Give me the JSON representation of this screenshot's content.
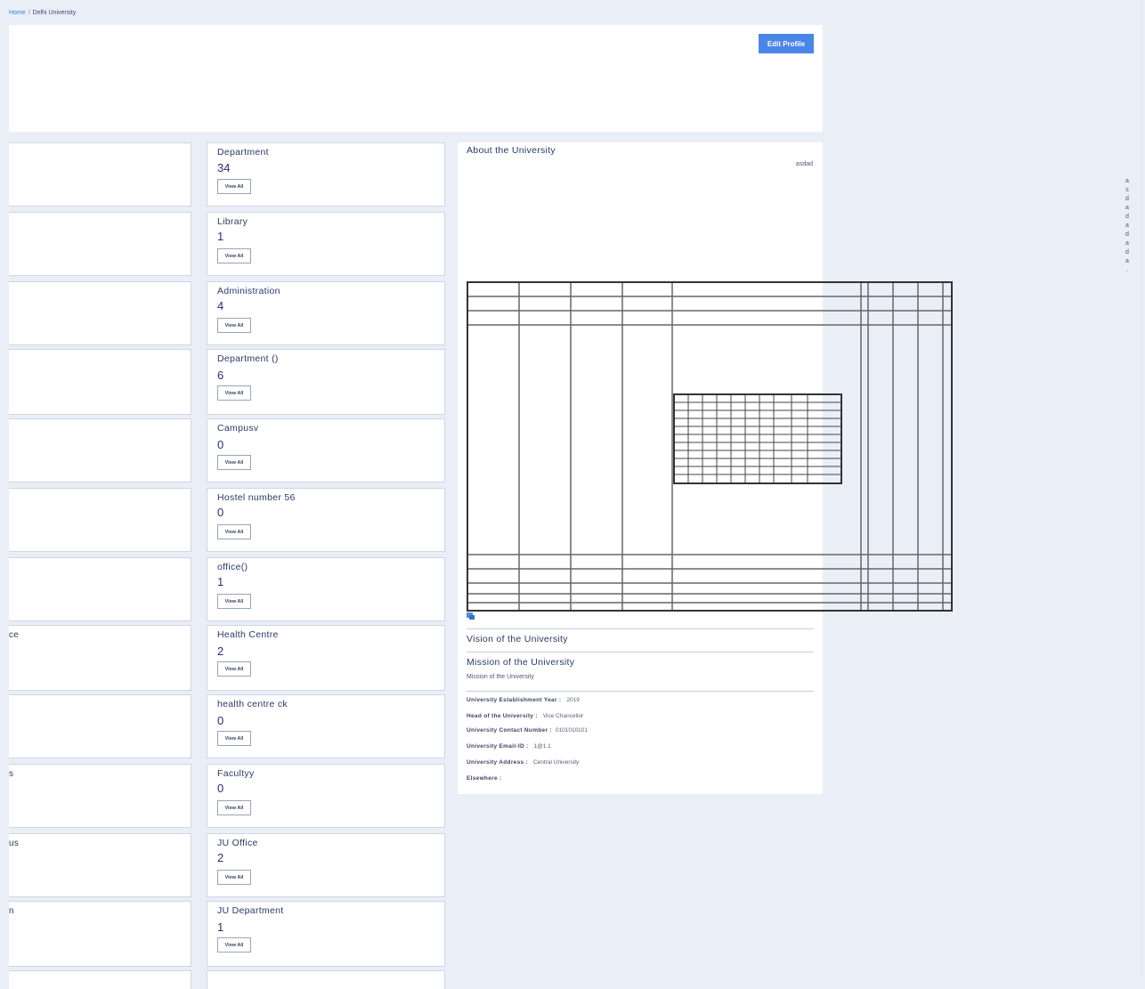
{
  "breadcrumb": {
    "home": "Home",
    "separator": "/",
    "current": "Delhi University"
  },
  "header": {
    "edit_profile": "Edit Profile"
  },
  "left_cards": [
    "",
    "",
    "",
    "",
    "",
    "",
    "",
    "ce",
    "",
    "s",
    "us",
    "n"
  ],
  "mid_cards": [
    {
      "title": "Department",
      "count": "34",
      "view": "View All"
    },
    {
      "title": "Library",
      "count": "1",
      "view": "View All"
    },
    {
      "title": "Administration",
      "count": "4",
      "view": "View All"
    },
    {
      "title": "Department ()",
      "count": "6",
      "view": "View All"
    },
    {
      "title": "Campusv",
      "count": "0",
      "view": "View All"
    },
    {
      "title": "Hostel number 56",
      "count": "0",
      "view": "View All"
    },
    {
      "title": "office()",
      "count": "1",
      "view": "View All"
    },
    {
      "title": "Health Centre",
      "count": "2",
      "view": "View All"
    },
    {
      "title": "health centre ck",
      "count": "0",
      "view": "View All"
    },
    {
      "title": "Facultyy",
      "count": "0",
      "view": "View All"
    },
    {
      "title": "JU Office",
      "count": "2",
      "view": "View All"
    },
    {
      "title": "JU Department",
      "count": "1",
      "view": "View All"
    }
  ],
  "about": {
    "title": "About the University",
    "text": "asdad",
    "vision_title": "Vision of the University",
    "mission_title": "Mission of the University",
    "mission_text": "Mission of the University"
  },
  "info": [
    {
      "key": "University Establishment Year :",
      "value": "2019"
    },
    {
      "key": "Head of the University :",
      "value": "Vice Chancellor"
    },
    {
      "key": "University Contact Number :",
      "value": "0101010101"
    },
    {
      "key": "University Email-ID :",
      "value": "1@1.1"
    },
    {
      "key": "University Address :",
      "value": "Central University"
    },
    {
      "key": "Elsewhere :",
      "value": ""
    }
  ],
  "vertical_text": [
    "a",
    "s",
    "d",
    "a",
    "d",
    "a",
    "d",
    "a",
    "d",
    "a",
    "."
  ],
  "colors": {
    "accent": "#4a86e8",
    "background": "#eaeef7",
    "text": "#2a3a66"
  }
}
